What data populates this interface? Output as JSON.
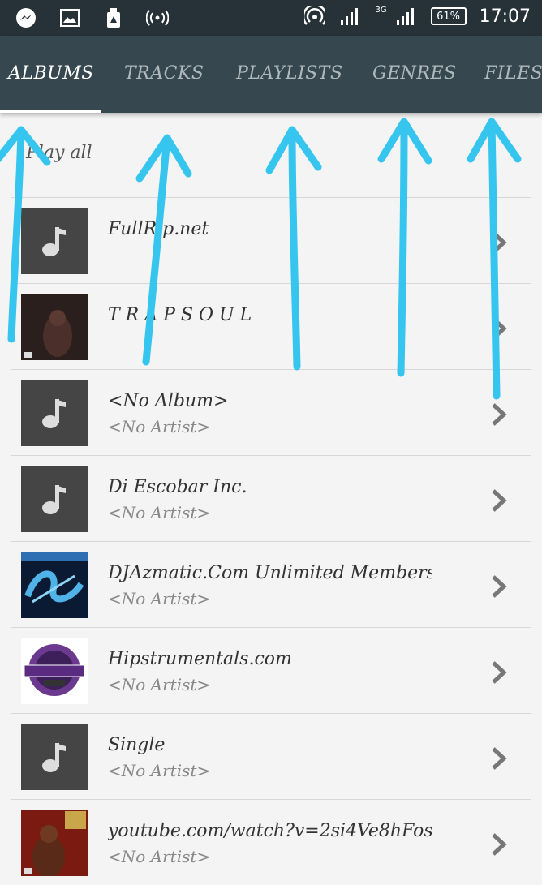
{
  "status_bar": {
    "time": "17:07",
    "battery": "61%",
    "network": "3G",
    "icons": [
      "messenger-icon",
      "image-icon",
      "cleaner-icon",
      "wireless-icon",
      "hotspot-icon",
      "signal-icon",
      "signal-3g-icon"
    ]
  },
  "tabs": [
    {
      "label": "ALBUMS",
      "active": true
    },
    {
      "label": "TRACKS",
      "active": false
    },
    {
      "label": "PLAYLISTS",
      "active": false
    },
    {
      "label": "GENRES",
      "active": false
    },
    {
      "label": "FILES",
      "active": false
    }
  ],
  "play_all_label": "Play all",
  "albums": [
    {
      "title": "FullRip.net",
      "artist": "",
      "thumb": "note-icon"
    },
    {
      "title": "T R A P S O U L",
      "artist": "",
      "thumb": "trapsoul-cover"
    },
    {
      "title": "<No Album>",
      "artist": "<No Artist>",
      "thumb": "note-icon"
    },
    {
      "title": "Di Escobar Inc.",
      "artist": "<No Artist>",
      "thumb": "note-icon"
    },
    {
      "title": "DJAzmatic.Com Unlimited Membership",
      "artist": "<No Artist>",
      "thumb": "djazmatic-cover"
    },
    {
      "title": "Hipstrumentals.com",
      "artist": "<No Artist>",
      "thumb": "hipstrumentals-cover"
    },
    {
      "title": "Single",
      "artist": "<No Artist>",
      "thumb": "note-icon"
    },
    {
      "title": "youtube.com/watch?v=2si4Ve8hFos",
      "artist": "<No Artist>",
      "thumb": "50cent-cover"
    }
  ],
  "colors": {
    "status_bar": "#263238",
    "tab_bar": "#37474f",
    "annotation_arrow": "#35c5ee"
  }
}
